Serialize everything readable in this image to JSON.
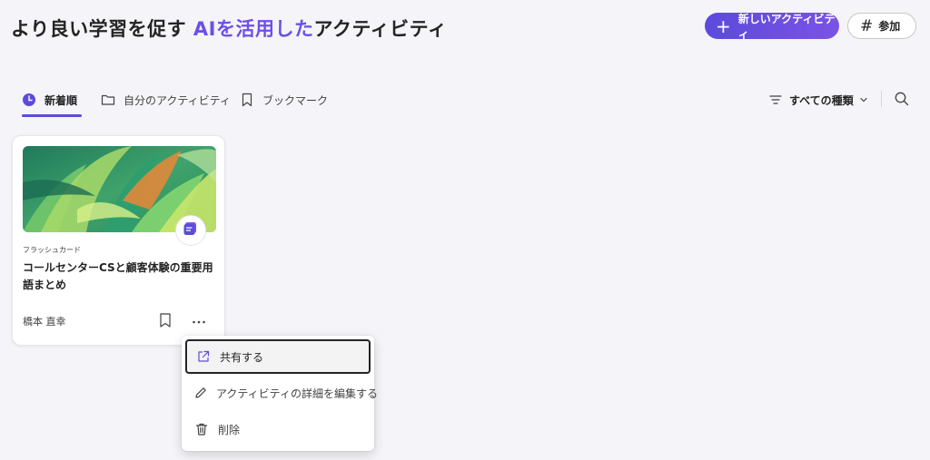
{
  "header": {
    "title_prefix": "より良い学習を促す ",
    "title_accent": "AIを活用した",
    "title_suffix": "アクティビティ",
    "new_activity_label": "新しいアクティビティ",
    "join_label": "参加"
  },
  "tabs": [
    {
      "label": "新着順",
      "icon": "clock-icon",
      "active": true
    },
    {
      "label": "自分のアクティビティ",
      "icon": "folder-icon",
      "active": false
    },
    {
      "label": "ブックマーク",
      "icon": "bookmark-icon",
      "active": false
    }
  ],
  "filter": {
    "label": "すべての種類"
  },
  "card": {
    "type_label": "フラッシュカード",
    "title": "コールセンターCSと顧客体験の重要用語まとめ",
    "author": "橋本 直幸"
  },
  "context_menu": {
    "items": [
      {
        "label": "共有する",
        "icon": "share-icon"
      },
      {
        "label": "アクティビティの詳細を編集する",
        "icon": "pencil-icon"
      },
      {
        "label": "削除",
        "icon": "trash-icon"
      }
    ]
  },
  "colors": {
    "accent": "#6c4fe8",
    "primary_button": "#5b4bdb",
    "background": "#f5f4f8"
  }
}
